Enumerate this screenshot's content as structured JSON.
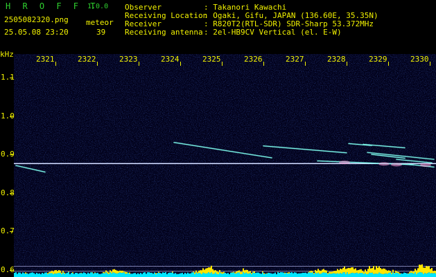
{
  "app": {
    "name": "H R O F F T",
    "version": "1.0.0"
  },
  "file": {
    "name": "2505082320.png",
    "datetime": "25.05.08 23:20"
  },
  "meteor": {
    "label": "meteor",
    "count": "39"
  },
  "station": [
    {
      "key": "Observer",
      "value": ": Takanori Kawachi"
    },
    {
      "key": "Receiving Location",
      "value": ": Ogaki, Gifu, JAPAN (136.60E, 35.35N)"
    },
    {
      "key": "Receiver",
      "value": ": R820T2(RTL-SDR) SDR-Sharp 53.372MHz"
    },
    {
      "key": "Receiving antenna",
      "value": ": 2el-HB9CV Vertical (el. E-W)"
    }
  ],
  "colors": {
    "text": "#f2f200",
    "logo": "#2fd02f",
    "background": "#02021c",
    "carrier": "#b8c8ff",
    "echo": "#7ffff0",
    "noise_floor": "#00e5ff",
    "noise_peak": "#ffe600"
  },
  "chart_data": {
    "type": "heatmap",
    "xlabel": "",
    "ylabel": "kHz",
    "x_ticks": [
      "2321",
      "2322",
      "2323",
      "2324",
      "2325",
      "2326",
      "2327",
      "2328",
      "2329",
      "2330"
    ],
    "y_ticks": [
      "1.1",
      "1.0",
      "0.9",
      "0.8",
      "0.7",
      "0.6"
    ],
    "xlim": [
      2320.0,
      2330.15
    ],
    "ylim": [
      0.582,
      1.162
    ],
    "carrier_khz": 0.877,
    "echoes": [
      {
        "t_start": 2320.05,
        "t_end": 2320.75,
        "khz_start": 0.872,
        "khz_end": 0.855
      },
      {
        "t_start": 2323.85,
        "t_end": 2326.2,
        "khz_start": 0.932,
        "khz_end": 0.892
      },
      {
        "t_start": 2326.0,
        "t_end": 2328.0,
        "khz_start": 0.923,
        "khz_end": 0.905
      },
      {
        "t_start": 2328.05,
        "t_end": 2328.6,
        "khz_start": 0.929,
        "khz_end": 0.924
      },
      {
        "t_start": 2328.4,
        "t_end": 2329.4,
        "khz_start": 0.927,
        "khz_end": 0.918
      },
      {
        "t_start": 2327.3,
        "t_end": 2329.6,
        "khz_start": 0.884,
        "khz_end": 0.874
      },
      {
        "t_start": 2328.5,
        "t_end": 2330.1,
        "khz_start": 0.906,
        "khz_end": 0.888
      },
      {
        "t_start": 2328.6,
        "t_end": 2329.4,
        "khz_start": 0.901,
        "khz_end": 0.891
      },
      {
        "t_start": 2329.2,
        "t_end": 2330.05,
        "khz_start": 0.888,
        "khz_end": 0.879
      },
      {
        "t_start": 2329.5,
        "t_end": 2330.1,
        "khz_start": 0.875,
        "khz_end": 0.868
      }
    ],
    "bursts": [
      {
        "t": 2327.95,
        "khz": 0.88
      },
      {
        "t": 2328.9,
        "khz": 0.876
      },
      {
        "t": 2329.2,
        "khz": 0.874
      },
      {
        "t": 2329.9,
        "khz": 0.873
      }
    ],
    "grid": false,
    "legend": "none"
  }
}
